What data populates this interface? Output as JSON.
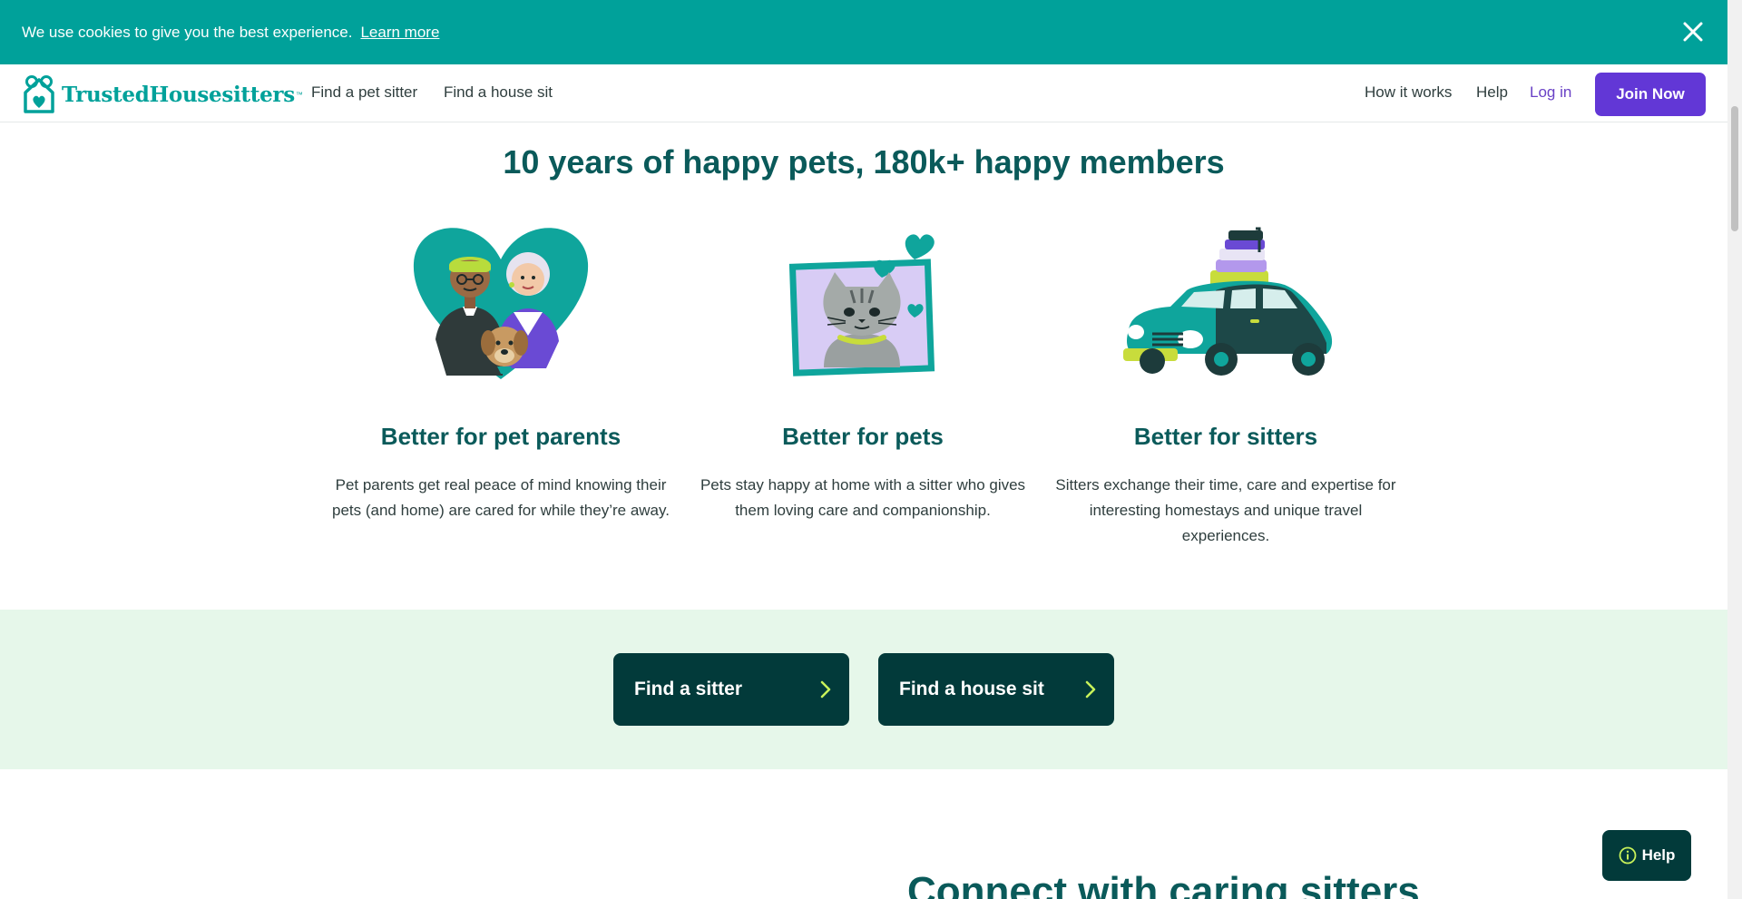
{
  "cookie": {
    "message": "We use cookies to give you the best experience.",
    "learn_more": "Learn more"
  },
  "nav": {
    "brand": "TrustedHousesitters",
    "brand_tm": "™",
    "find_pet_sitter": "Find a pet sitter",
    "find_house_sit": "Find a house sit",
    "how_it_works": "How it works",
    "help": "Help",
    "log_in": "Log in",
    "join_now": "Join Now"
  },
  "headline": "10 years of happy pets, 180k+ happy members",
  "features": [
    {
      "title": "Better for pet parents",
      "description": "Pet parents get real peace of mind knowing their pets (and home) are cared for while they’re away.",
      "illustration": "heart-couple-dog-illustration"
    },
    {
      "title": "Better for pets",
      "description": "Pets stay happy at home with a sitter who gives them loving care and companionship.",
      "illustration": "cat-portrait-hearts-illustration"
    },
    {
      "title": "Better for sitters",
      "description": "Sitters exchange their time, care and expertise for interesting homestays and unique travel experiences.",
      "illustration": "car-with-luggage-illustration"
    }
  ],
  "cta": {
    "find_sitter": "Find a sitter",
    "find_house_sit": "Find a house sit"
  },
  "next_section_heading": "Connect with caring sitters",
  "help_widget": "Help",
  "colors": {
    "cookie_bar": "#00a19a",
    "brand_teal": "#00a19a",
    "heading_teal": "#0a5a5a",
    "join_button": "#6237d6",
    "cta_dark": "#023a3a",
    "cta_band": "#e6f7ea",
    "cta_chevron": "#c8f25a"
  }
}
